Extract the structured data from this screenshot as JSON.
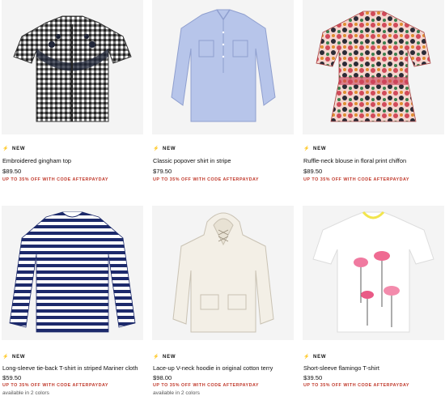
{
  "products": [
    {
      "badge": "NEW",
      "name": "Embroidered gingham top",
      "price": "$89.50",
      "promo": "UP TO 35% OFF WITH CODE AFTERPAYDAY",
      "colors": "",
      "image": "embroidered-gingham-top-image"
    },
    {
      "badge": "NEW",
      "name": "Classic popover shirt in stripe",
      "price": "$79.50",
      "promo": "UP TO 35% OFF WITH CODE AFTERPAYDAY",
      "colors": "",
      "image": "popover-shirt-image"
    },
    {
      "badge": "NEW",
      "name": "Ruffle-neck blouse in floral print chiffon",
      "price": "$89.50",
      "promo": "UP TO 35% OFF WITH CODE AFTERPAYDAY",
      "colors": "",
      "image": "floral-blouse-image"
    },
    {
      "badge": "NEW",
      "name": "Long-sleeve tie-back T-shirt in striped Mariner cloth",
      "price": "$59.50",
      "promo": "UP TO 35% OFF WITH CODE AFTERPAYDAY",
      "colors": "available in 2 colors",
      "image": "striped-tshirt-image"
    },
    {
      "badge": "NEW",
      "name": "Lace-up V-neck hoodie in original cotton terry",
      "price": "$98.00",
      "promo": "UP TO 35% OFF WITH CODE AFTERPAYDAY",
      "colors": "available in 2 colors",
      "image": "hoodie-image"
    },
    {
      "badge": "NEW",
      "name": "Short-sleeve flamingo T-shirt",
      "price": "$39.50",
      "promo": "UP TO 35% OFF WITH CODE AFTERPAYDAY",
      "colors": "",
      "image": "flamingo-tshirt-image"
    }
  ],
  "colors": {
    "promo": "#c0392b",
    "text": "#111111",
    "image_bg": "#f4f4f4"
  }
}
